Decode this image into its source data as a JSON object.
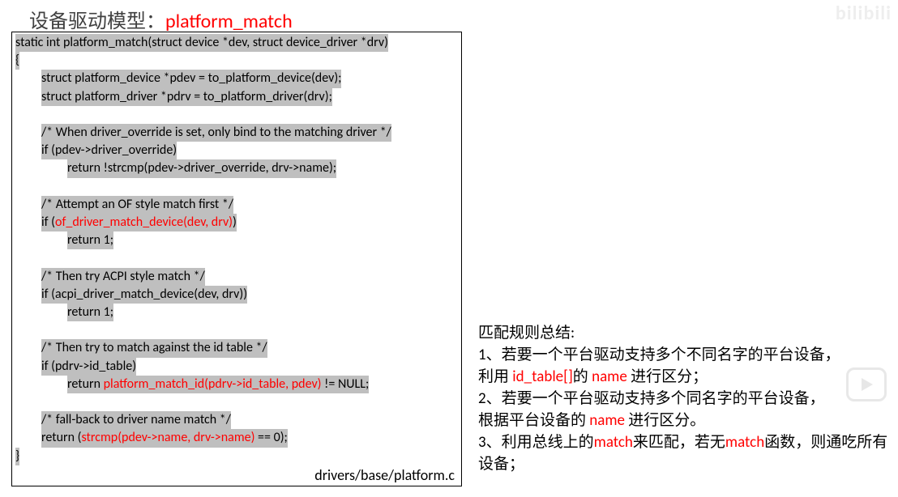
{
  "title": {
    "prefix": "设备驱动模型：",
    "highlighted": "platform_match"
  },
  "code": {
    "source_file": "drivers/base/platform.c",
    "lines": [
      {
        "indent": 0,
        "segments": [
          {
            "text": "static int platform_match(struct device *dev, struct device_driver *drv)",
            "cls": "bg"
          }
        ]
      },
      {
        "indent": 0,
        "segments": [
          {
            "text": "{",
            "cls": "bg"
          }
        ]
      },
      {
        "indent": 1,
        "segments": [
          {
            "text": "struct platform_device *pdev = to_platform_device(dev);",
            "cls": "bg"
          }
        ]
      },
      {
        "indent": 1,
        "segments": [
          {
            "text": "struct platform_driver *pdrv = to_platform_driver(drv);",
            "cls": "bg"
          }
        ]
      },
      {
        "indent": 0,
        "segments": [
          {
            "text": "",
            "cls": ""
          }
        ]
      },
      {
        "indent": 1,
        "segments": [
          {
            "text": "/* When driver_override is set, only bind to the matching driver */",
            "cls": "bg"
          }
        ]
      },
      {
        "indent": 1,
        "segments": [
          {
            "text": "if (pdev->driver_override)",
            "cls": "bg"
          }
        ]
      },
      {
        "indent": 2,
        "segments": [
          {
            "text": "return !strcmp(pdev->driver_override, drv->name);",
            "cls": "bg"
          }
        ]
      },
      {
        "indent": 0,
        "segments": [
          {
            "text": "",
            "cls": ""
          }
        ]
      },
      {
        "indent": 1,
        "segments": [
          {
            "text": "/* Attempt an OF style match first */",
            "cls": "bg"
          }
        ]
      },
      {
        "indent": 1,
        "segments": [
          {
            "text": "if (",
            "cls": "bg"
          },
          {
            "text": "of_driver_match_device(dev, drv)",
            "cls": "bg red"
          },
          {
            "text": ")",
            "cls": "bg"
          }
        ]
      },
      {
        "indent": 2,
        "segments": [
          {
            "text": "return 1;",
            "cls": "bg"
          }
        ]
      },
      {
        "indent": 0,
        "segments": [
          {
            "text": "",
            "cls": ""
          }
        ]
      },
      {
        "indent": 1,
        "segments": [
          {
            "text": "/* Then try ACPI style match */",
            "cls": "bg"
          }
        ]
      },
      {
        "indent": 1,
        "segments": [
          {
            "text": "if (acpi_driver_match_device(dev, drv))",
            "cls": "bg"
          }
        ]
      },
      {
        "indent": 2,
        "segments": [
          {
            "text": "return 1;",
            "cls": "bg"
          }
        ]
      },
      {
        "indent": 0,
        "segments": [
          {
            "text": "",
            "cls": ""
          }
        ]
      },
      {
        "indent": 1,
        "segments": [
          {
            "text": "/* Then try to match against the id table */",
            "cls": "bg"
          }
        ]
      },
      {
        "indent": 1,
        "segments": [
          {
            "text": "if (pdrv->id_table)",
            "cls": "bg"
          }
        ]
      },
      {
        "indent": 2,
        "segments": [
          {
            "text": "return ",
            "cls": "bg"
          },
          {
            "text": "platform_match_id(pdrv->id_table, pdev)",
            "cls": "bg red"
          },
          {
            "text": " != NULL;",
            "cls": "bg"
          }
        ]
      },
      {
        "indent": 0,
        "segments": [
          {
            "text": "",
            "cls": ""
          }
        ]
      },
      {
        "indent": 1,
        "segments": [
          {
            "text": "/* fall-back to driver name match */",
            "cls": "bg"
          }
        ]
      },
      {
        "indent": 1,
        "segments": [
          {
            "text": "return (",
            "cls": "bg"
          },
          {
            "text": "strcmp(pdev->name, drv->name)",
            "cls": "bg red"
          },
          {
            "text": " == 0);",
            "cls": "bg"
          }
        ]
      },
      {
        "indent": 0,
        "segments": [
          {
            "text": "}",
            "cls": "bg"
          }
        ]
      }
    ]
  },
  "notes": {
    "heading": "匹配规则总结:",
    "line1_a": "1、若要一个平台驱动支持多个不同名字的平台设备，",
    "line1_b_pre": "利用 ",
    "line1_b_hl1": "id_table[]",
    "line1_b_mid": "的 ",
    "line1_b_hl2": "name",
    "line1_b_post": " 进行区分；",
    "line2_a": "2、若要一个平台驱动支持多个同名字的平台设备，",
    "line2_b_pre": "根据平台设备的 ",
    "line2_b_hl": "name",
    "line2_b_post": " 进行区分。",
    "line3_pre": "3、利用总线上的",
    "line3_hl1": "match",
    "line3_mid": "来匹配，若无",
    "line3_hl2": "match",
    "line3_post": "函数，则通吃所有设备；"
  },
  "watermark": "bilibili"
}
